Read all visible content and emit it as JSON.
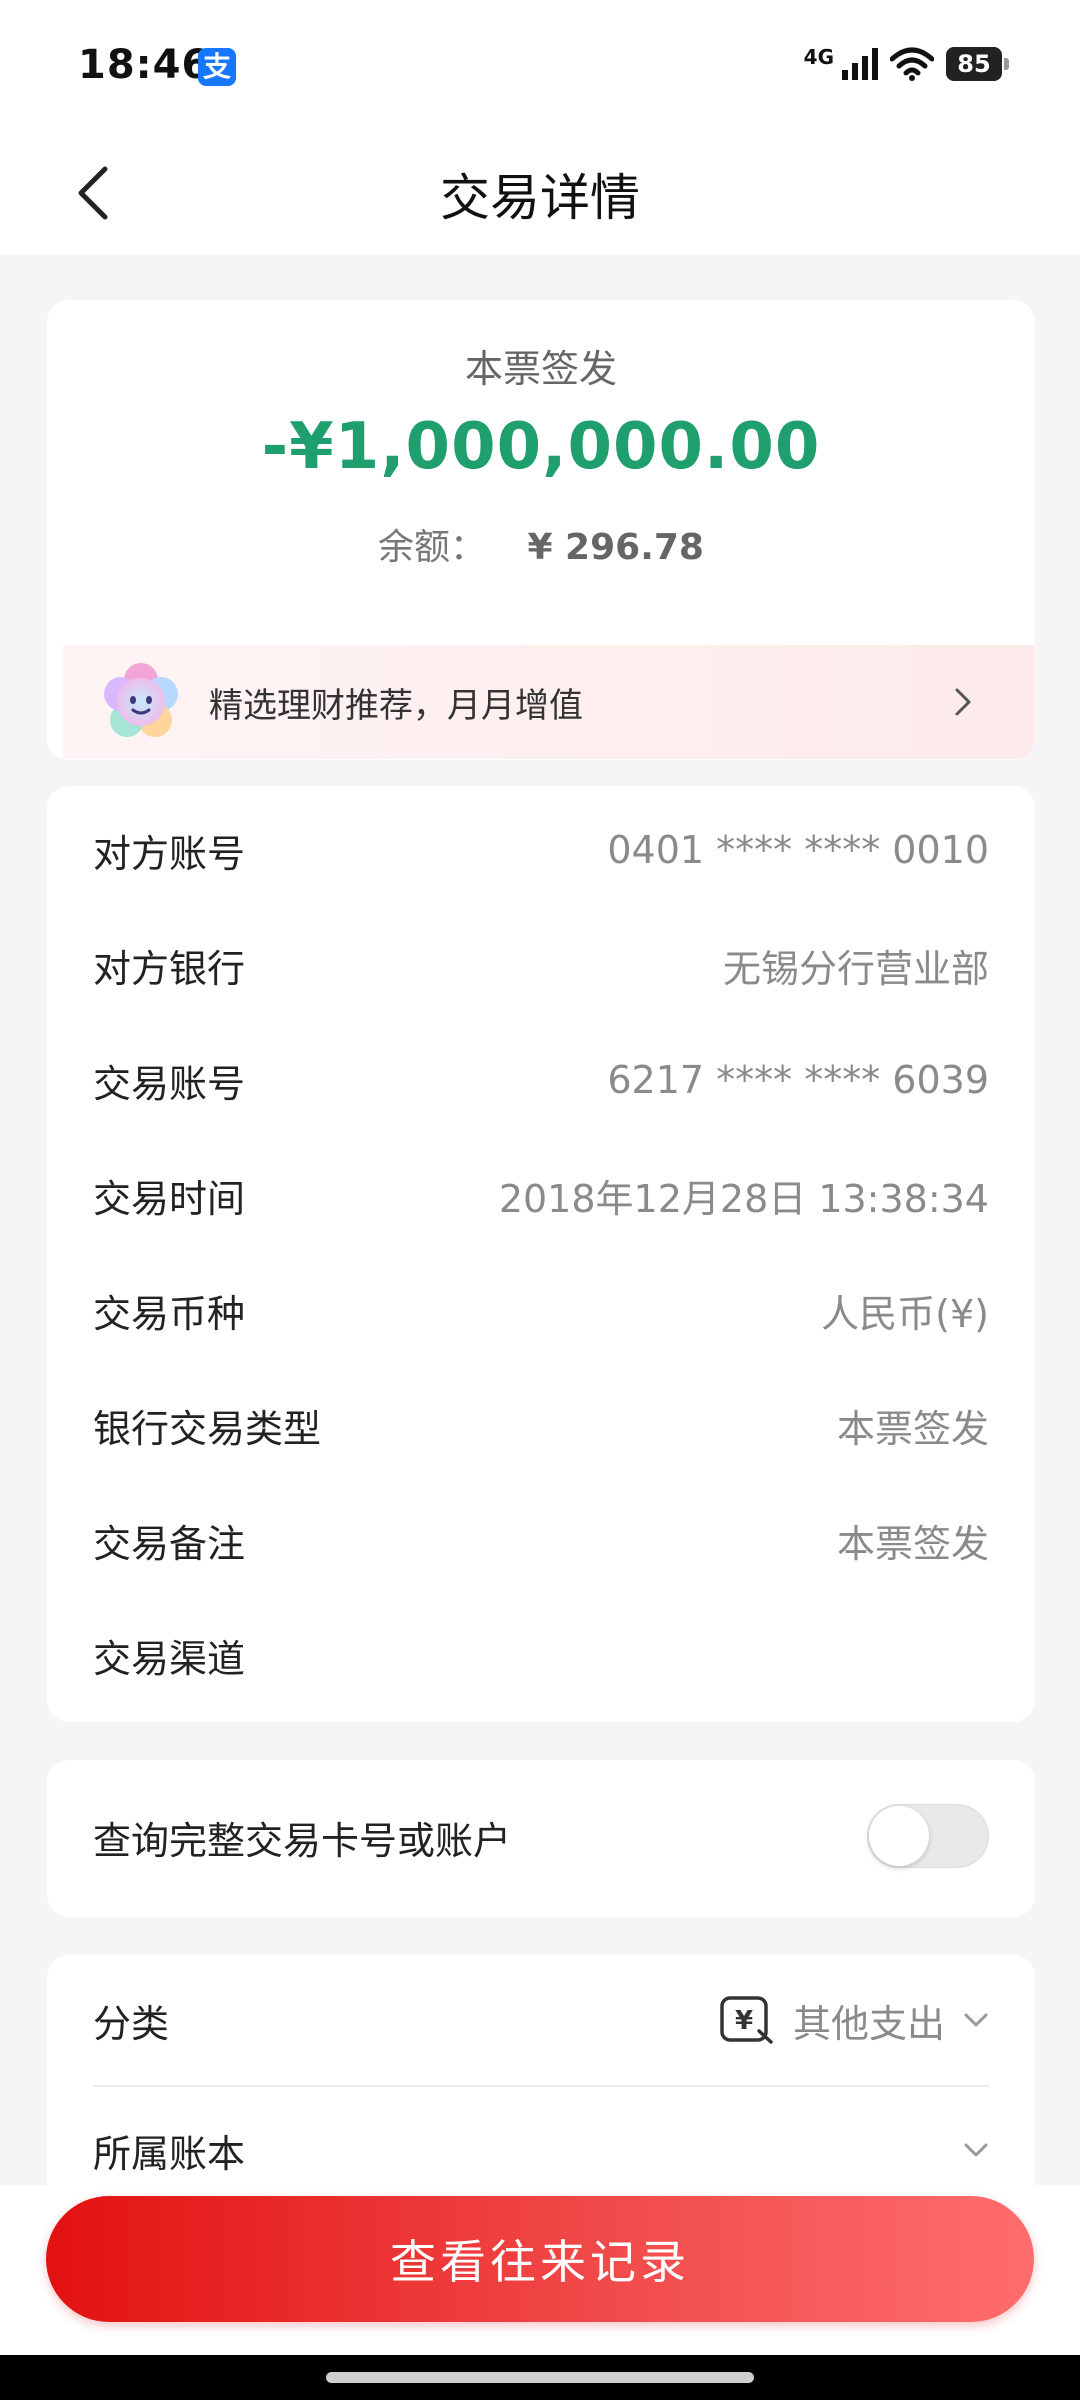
{
  "status_bar": {
    "time": "18:46",
    "app_badge": "支",
    "network": "4G",
    "battery": "85"
  },
  "header": {
    "title": "交易详情"
  },
  "summary": {
    "type": "本票签发",
    "amount": "-¥1,000,000.00",
    "balance_label": "余额：",
    "balance_value": "¥ 296.78"
  },
  "promo": {
    "text": "精选理财推荐，月月增值"
  },
  "details": [
    {
      "label": "对方账号",
      "value": "0401 **** **** 0010"
    },
    {
      "label": "对方银行",
      "value": "无锡分行营业部"
    },
    {
      "label": "交易账号",
      "value": "6217 **** **** 6039"
    },
    {
      "label": "交易时间",
      "value": "2018年12月28日 13:38:34"
    },
    {
      "label": "交易币种",
      "value": "人民币(¥)"
    },
    {
      "label": "银行交易类型",
      "value": "本票签发"
    },
    {
      "label": "交易备注",
      "value": "本票签发"
    },
    {
      "label": "交易渠道",
      "value": ""
    }
  ],
  "toggle": {
    "label": "查询完整交易卡号或账户",
    "checked": false
  },
  "category": {
    "label": "分类",
    "value": "其他支出",
    "icon_glyph": "¥"
  },
  "ledger": {
    "label": "所属账本",
    "value": ""
  },
  "bottom_button": {
    "label": "查看往来记录"
  },
  "colors": {
    "amount_green": "#1f9f6e",
    "button_red": "#e31111",
    "background": "#f5f5f7"
  }
}
